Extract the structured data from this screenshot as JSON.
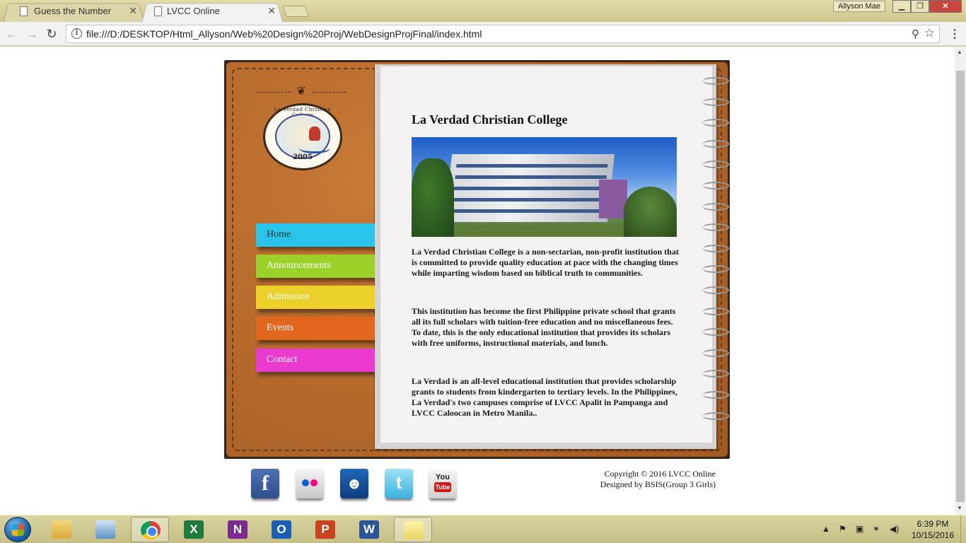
{
  "browser": {
    "tabs": [
      {
        "title": "Guess the Number",
        "active": false
      },
      {
        "title": "LVCC Online",
        "active": true
      }
    ],
    "user_name": "Allyson Mae",
    "url": "file:///D:/DESKTOP/Html_Allyson/Web%20Design%20Proj/WebDesignProjFinal/index.html"
  },
  "site": {
    "logo": {
      "name": "La Verdad Christian College",
      "year": "2005"
    },
    "menu": [
      {
        "label": "Home",
        "color": "#2ac4ea"
      },
      {
        "label": "Announcements",
        "color": "#9bd22a"
      },
      {
        "label": "Admission",
        "color": "#ebd12a"
      },
      {
        "label": "Events",
        "color": "#e2671e"
      },
      {
        "label": "Contact",
        "color": "#ea3ad0"
      }
    ],
    "content": {
      "title": "La Verdad Christian College",
      "paragraphs": [
        "La Verdad Christian College is a non-sectarian, non-profit institution that is committed to provide quality education at pace with the changing times while imparting wisdom based on biblical truth to communities.",
        "This institution has become the first Philippine private school that grants all its full scholars with tuition-free education and no miscellaneous fees. To date, this is the only educational institution that provides its scholars with free uniforms, instructional materials, and lunch.",
        "La Verdad is an all-level educational institution that provides scholarship grants to students from kindergarten to tertiary levels. In the Philippines, La Verdad's two campuses comprise of LVCC Apalit in Pampanga and LVCC Caloocan in Metro Manila.."
      ]
    },
    "social": [
      {
        "name": "facebook",
        "glyph": "f"
      },
      {
        "name": "flickr",
        "glyph": ""
      },
      {
        "name": "myspace",
        "glyph": "☻"
      },
      {
        "name": "twitter",
        "glyph": "t"
      },
      {
        "name": "youtube",
        "you": "You",
        "tube": "Tube"
      }
    ],
    "footer": {
      "copyright": "Copyright © 2016 LVCC Online",
      "designed_by": "Designed by BSIS(Group 3 Girls)"
    }
  },
  "taskbar": {
    "apps": [
      {
        "name": "file-explorer",
        "glyph": "",
        "selected": false
      },
      {
        "name": "virtualbox",
        "glyph": "",
        "selected": false
      },
      {
        "name": "chrome",
        "glyph": "",
        "selected": true
      },
      {
        "name": "excel",
        "glyph": "X",
        "selected": false
      },
      {
        "name": "onenote",
        "glyph": "N",
        "selected": false
      },
      {
        "name": "outlook",
        "glyph": "O",
        "selected": false
      },
      {
        "name": "powerpoint",
        "glyph": "P",
        "selected": false
      },
      {
        "name": "word",
        "glyph": "W",
        "selected": false
      },
      {
        "name": "sticky-notes",
        "glyph": "",
        "selected": true
      }
    ],
    "time": "6:39 PM",
    "date": "10/15/2016"
  }
}
